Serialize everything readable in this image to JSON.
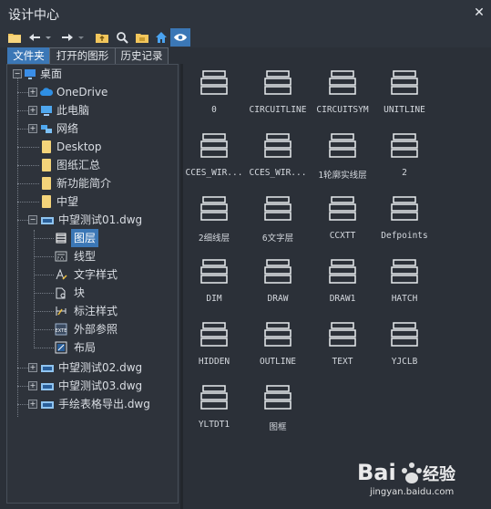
{
  "window": {
    "title": "设计中心",
    "close_icon": "close-icon"
  },
  "toolbar": {
    "icons": [
      "load-folder-icon",
      "back-icon",
      "dropdown-icon",
      "forward-icon",
      "dropdown-icon",
      "up-folder-icon",
      "search-icon",
      "favorites-icon",
      "home-icon",
      "preview-toggle-icon"
    ]
  },
  "tabs": [
    {
      "label": "文件夹",
      "active": true
    },
    {
      "label": "打开的图形",
      "active": false
    },
    {
      "label": "历史记录",
      "active": false
    }
  ],
  "tree": {
    "root": "桌面",
    "items": [
      {
        "label": "OneDrive",
        "icon": "cloud-icon"
      },
      {
        "label": "此电脑",
        "icon": "computer-icon"
      },
      {
        "label": "网络",
        "icon": "network-icon"
      },
      {
        "label": "Desktop",
        "icon": "folder-icon"
      },
      {
        "label": "图纸汇总",
        "icon": "folder-icon"
      },
      {
        "label": "新功能简介",
        "icon": "folder-icon"
      },
      {
        "label": "中望",
        "icon": "folder-icon"
      },
      {
        "label": "中望测试01.dwg",
        "icon": "dwg-icon"
      }
    ],
    "children": [
      {
        "label": "图层",
        "icon": "layer-icon",
        "selected": true
      },
      {
        "label": "线型",
        "icon": "linetype-icon"
      },
      {
        "label": "文字样式",
        "icon": "textstyle-icon"
      },
      {
        "label": "块",
        "icon": "block-icon"
      },
      {
        "label": "标注样式",
        "icon": "dimstyle-icon"
      },
      {
        "label": "外部参照",
        "icon": "xref-icon"
      },
      {
        "label": "布局",
        "icon": "layout-icon"
      }
    ],
    "after": [
      {
        "label": "中望测试02.dwg",
        "icon": "dwg-icon"
      },
      {
        "label": "中望测试03.dwg",
        "icon": "dwg-icon"
      },
      {
        "label": "手绘表格导出.dwg",
        "icon": "dwg-icon"
      }
    ]
  },
  "layers": [
    "0",
    "CIRCUITLINE",
    "CIRCUITSYM",
    "UNITLINE",
    "CCES_WIR...",
    "CCES_WIR...",
    "1轮廓实线层",
    "2",
    "2细线层",
    "6文字层",
    "CCXTT",
    "Defpoints",
    "DIM",
    "DRAW",
    "DRAW1",
    "HATCH",
    "HIDDEN",
    "OUTLINE",
    "TEXT",
    "YJCLB",
    "YLTDT1",
    "图框"
  ],
  "watermark": {
    "logo": "Bai du 经验",
    "url": "jingyan.baidu.com"
  }
}
